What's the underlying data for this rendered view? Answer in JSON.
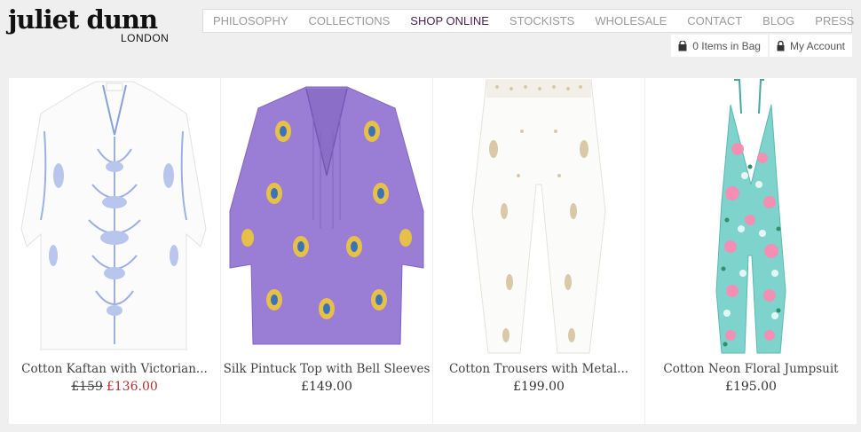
{
  "brand": {
    "name": "juliet dunn",
    "sub": "LONDON"
  },
  "nav": [
    {
      "label": "PHILOSOPHY"
    },
    {
      "label": "COLLECTIONS"
    },
    {
      "label": "SHOP ONLINE"
    },
    {
      "label": "STOCKISTS"
    },
    {
      "label": "WHOLESALE"
    },
    {
      "label": "CONTACT"
    },
    {
      "label": "BLOG"
    },
    {
      "label": "PRESS"
    }
  ],
  "utility": {
    "bag": "0 Items in Bag",
    "account": "My Account"
  },
  "products": [
    {
      "name": "Cotton Kaftan with Victorian...",
      "old_price": "£159",
      "price": "£136.00"
    },
    {
      "name": "Silk Pintuck Top with Bell Sleeves",
      "price": "£149.00"
    },
    {
      "name": "Cotton Trousers with Metal...",
      "price": "£199.00"
    },
    {
      "name": "Cotton Neon Floral Jumpsuit",
      "price": "£195.00"
    }
  ],
  "colors": {
    "nav_active": "#4a1f4f",
    "sale": "#b13030"
  }
}
